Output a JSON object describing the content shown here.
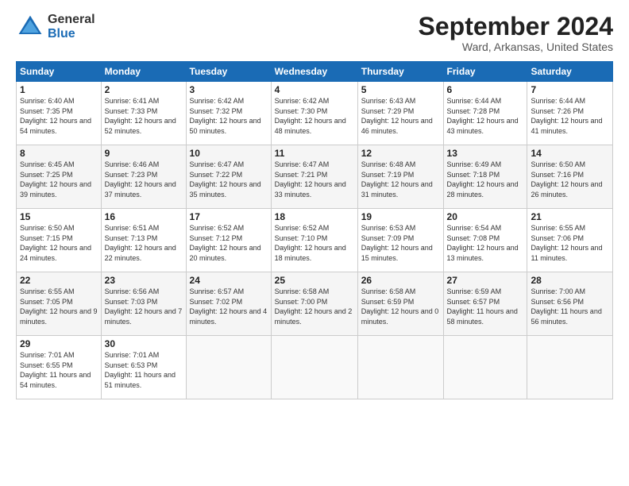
{
  "header": {
    "logo": {
      "general": "General",
      "blue": "Blue"
    },
    "title": "September 2024",
    "location": "Ward, Arkansas, United States"
  },
  "days_of_week": [
    "Sunday",
    "Monday",
    "Tuesday",
    "Wednesday",
    "Thursday",
    "Friday",
    "Saturday"
  ],
  "weeks": [
    [
      {
        "day": "1",
        "sunrise": "6:40 AM",
        "sunset": "7:35 PM",
        "daylight": "12 hours and 54 minutes."
      },
      {
        "day": "2",
        "sunrise": "6:41 AM",
        "sunset": "7:33 PM",
        "daylight": "12 hours and 52 minutes."
      },
      {
        "day": "3",
        "sunrise": "6:42 AM",
        "sunset": "7:32 PM",
        "daylight": "12 hours and 50 minutes."
      },
      {
        "day": "4",
        "sunrise": "6:42 AM",
        "sunset": "7:30 PM",
        "daylight": "12 hours and 48 minutes."
      },
      {
        "day": "5",
        "sunrise": "6:43 AM",
        "sunset": "7:29 PM",
        "daylight": "12 hours and 46 minutes."
      },
      {
        "day": "6",
        "sunrise": "6:44 AM",
        "sunset": "7:28 PM",
        "daylight": "12 hours and 43 minutes."
      },
      {
        "day": "7",
        "sunrise": "6:44 AM",
        "sunset": "7:26 PM",
        "daylight": "12 hours and 41 minutes."
      }
    ],
    [
      {
        "day": "8",
        "sunrise": "6:45 AM",
        "sunset": "7:25 PM",
        "daylight": "12 hours and 39 minutes."
      },
      {
        "day": "9",
        "sunrise": "6:46 AM",
        "sunset": "7:23 PM",
        "daylight": "12 hours and 37 minutes."
      },
      {
        "day": "10",
        "sunrise": "6:47 AM",
        "sunset": "7:22 PM",
        "daylight": "12 hours and 35 minutes."
      },
      {
        "day": "11",
        "sunrise": "6:47 AM",
        "sunset": "7:21 PM",
        "daylight": "12 hours and 33 minutes."
      },
      {
        "day": "12",
        "sunrise": "6:48 AM",
        "sunset": "7:19 PM",
        "daylight": "12 hours and 31 minutes."
      },
      {
        "day": "13",
        "sunrise": "6:49 AM",
        "sunset": "7:18 PM",
        "daylight": "12 hours and 28 minutes."
      },
      {
        "day": "14",
        "sunrise": "6:50 AM",
        "sunset": "7:16 PM",
        "daylight": "12 hours and 26 minutes."
      }
    ],
    [
      {
        "day": "15",
        "sunrise": "6:50 AM",
        "sunset": "7:15 PM",
        "daylight": "12 hours and 24 minutes."
      },
      {
        "day": "16",
        "sunrise": "6:51 AM",
        "sunset": "7:13 PM",
        "daylight": "12 hours and 22 minutes."
      },
      {
        "day": "17",
        "sunrise": "6:52 AM",
        "sunset": "7:12 PM",
        "daylight": "12 hours and 20 minutes."
      },
      {
        "day": "18",
        "sunrise": "6:52 AM",
        "sunset": "7:10 PM",
        "daylight": "12 hours and 18 minutes."
      },
      {
        "day": "19",
        "sunrise": "6:53 AM",
        "sunset": "7:09 PM",
        "daylight": "12 hours and 15 minutes."
      },
      {
        "day": "20",
        "sunrise": "6:54 AM",
        "sunset": "7:08 PM",
        "daylight": "12 hours and 13 minutes."
      },
      {
        "day": "21",
        "sunrise": "6:55 AM",
        "sunset": "7:06 PM",
        "daylight": "12 hours and 11 minutes."
      }
    ],
    [
      {
        "day": "22",
        "sunrise": "6:55 AM",
        "sunset": "7:05 PM",
        "daylight": "12 hours and 9 minutes."
      },
      {
        "day": "23",
        "sunrise": "6:56 AM",
        "sunset": "7:03 PM",
        "daylight": "12 hours and 7 minutes."
      },
      {
        "day": "24",
        "sunrise": "6:57 AM",
        "sunset": "7:02 PM",
        "daylight": "12 hours and 4 minutes."
      },
      {
        "day": "25",
        "sunrise": "6:58 AM",
        "sunset": "7:00 PM",
        "daylight": "12 hours and 2 minutes."
      },
      {
        "day": "26",
        "sunrise": "6:58 AM",
        "sunset": "6:59 PM",
        "daylight": "12 hours and 0 minutes."
      },
      {
        "day": "27",
        "sunrise": "6:59 AM",
        "sunset": "6:57 PM",
        "daylight": "11 hours and 58 minutes."
      },
      {
        "day": "28",
        "sunrise": "7:00 AM",
        "sunset": "6:56 PM",
        "daylight": "11 hours and 56 minutes."
      }
    ],
    [
      {
        "day": "29",
        "sunrise": "7:01 AM",
        "sunset": "6:55 PM",
        "daylight": "11 hours and 54 minutes."
      },
      {
        "day": "30",
        "sunrise": "7:01 AM",
        "sunset": "6:53 PM",
        "daylight": "11 hours and 51 minutes."
      },
      null,
      null,
      null,
      null,
      null
    ]
  ]
}
